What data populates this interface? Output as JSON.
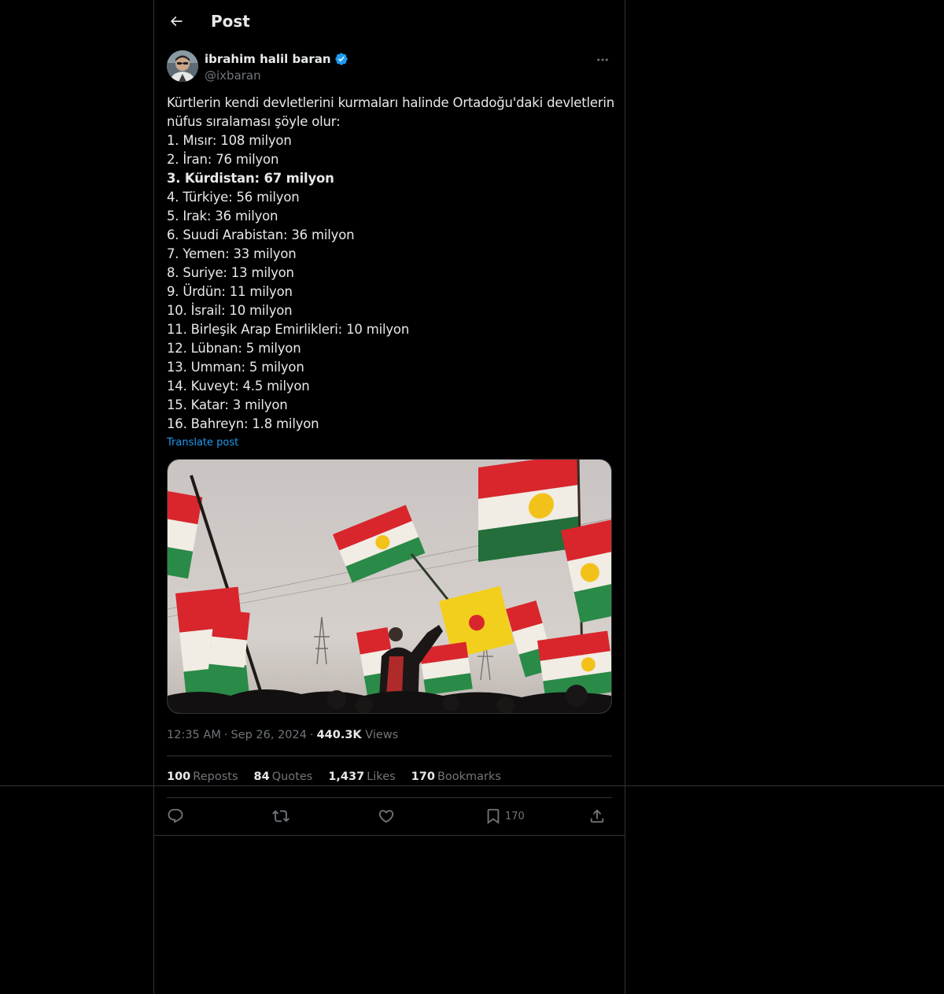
{
  "header": {
    "title": "Post"
  },
  "author": {
    "display_name": "ibrahim halil baran",
    "handle": "@ixbaran",
    "verified": true
  },
  "tweet": {
    "lines": [
      {
        "text": "Kürtlerin kendi devletlerini kurmaları halinde Ortadoğu'daki devletlerin",
        "bold": false
      },
      {
        "text": "nüfus sıralaması şöyle olur:",
        "bold": false
      },
      {
        "text": "1. Mısır: 108 milyon",
        "bold": false
      },
      {
        "text": "2. İran: 76 milyon",
        "bold": false
      },
      {
        "text": "3. Kürdistan: 67 milyon",
        "bold": true
      },
      {
        "text": "4. Türkiye: 56 milyon",
        "bold": false
      },
      {
        "text": "5. Irak: 36 milyon",
        "bold": false
      },
      {
        "text": "6. Suudi Arabistan: 36 milyon",
        "bold": false
      },
      {
        "text": "7. Yemen: 33 milyon",
        "bold": false
      },
      {
        "text": "8. Suriye: 13 milyon",
        "bold": false
      },
      {
        "text": "9. Ürdün: 11 milyon",
        "bold": false
      },
      {
        "text": "10. İsrail: 10 milyon",
        "bold": false
      },
      {
        "text": "11. Birleşik Arap Emirlikleri: 10 milyon",
        "bold": false
      },
      {
        "text": "12. Lübnan: 5 milyon",
        "bold": false
      },
      {
        "text": "13. Umman: 5 milyon",
        "bold": false
      },
      {
        "text": "14. Kuveyt: 4.5 milyon",
        "bold": false
      },
      {
        "text": "15. Katar: 3 milyon",
        "bold": false
      },
      {
        "text": "16. Bahreyn: 1.8 milyon",
        "bold": false
      }
    ],
    "translate_label": "Translate post"
  },
  "meta": {
    "time": "12:35 AM",
    "date": "Sep 26, 2024",
    "views_count": "440.3K",
    "views_label": "Views",
    "separator": "·"
  },
  "stats": {
    "reposts_count": "100",
    "reposts_label": "Reposts",
    "quotes_count": "84",
    "quotes_label": "Quotes",
    "likes_count": "1,437",
    "likes_label": "Likes",
    "bookmarks_count": "170",
    "bookmarks_label": "Bookmarks"
  },
  "actions": {
    "reply_icon": "reply-icon",
    "repost_icon": "repost-icon",
    "like_icon": "heart-icon",
    "bookmark_icon": "bookmark-icon",
    "bookmark_count": "170",
    "share_icon": "share-icon"
  },
  "colors": {
    "background": "#000000",
    "text": "#e7e9ea",
    "secondary": "#71767b",
    "accent": "#1d9bf0",
    "border": "#2f3336"
  }
}
